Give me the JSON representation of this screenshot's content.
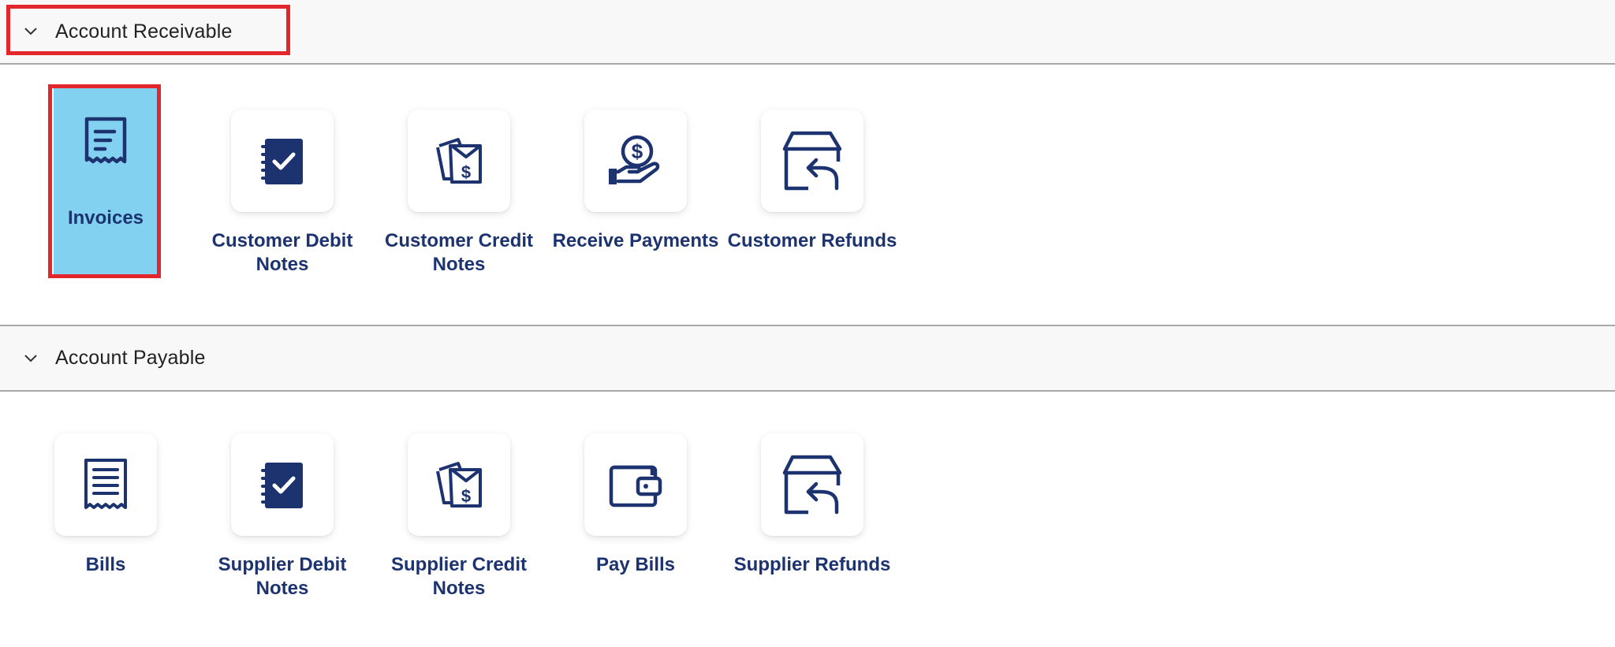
{
  "sections": {
    "receivable": {
      "title": "Account Receivable",
      "tiles": [
        {
          "label": "Invoices",
          "icon": "invoice-icon",
          "selected": true
        },
        {
          "label": "Customer Debit Notes",
          "icon": "notebook-check-icon"
        },
        {
          "label": "Customer Credit Notes",
          "icon": "credit-note-icon"
        },
        {
          "label": "Receive Payments",
          "icon": "hand-coin-icon"
        },
        {
          "label": "Customer Refunds",
          "icon": "box-return-icon"
        }
      ]
    },
    "payable": {
      "title": "Account Payable",
      "tiles": [
        {
          "label": "Bills",
          "icon": "receipt-icon"
        },
        {
          "label": "Supplier Debit Notes",
          "icon": "notebook-check-icon"
        },
        {
          "label": "Supplier Credit Notes",
          "icon": "credit-note-icon"
        },
        {
          "label": "Pay Bills",
          "icon": "wallet-icon"
        },
        {
          "label": "Supplier Refunds",
          "icon": "box-return-icon"
        }
      ]
    }
  },
  "colors": {
    "icon": "#1c3370",
    "label": "#1c3370",
    "selected_bg": "#82d1f0",
    "highlight": "#e3262b"
  }
}
